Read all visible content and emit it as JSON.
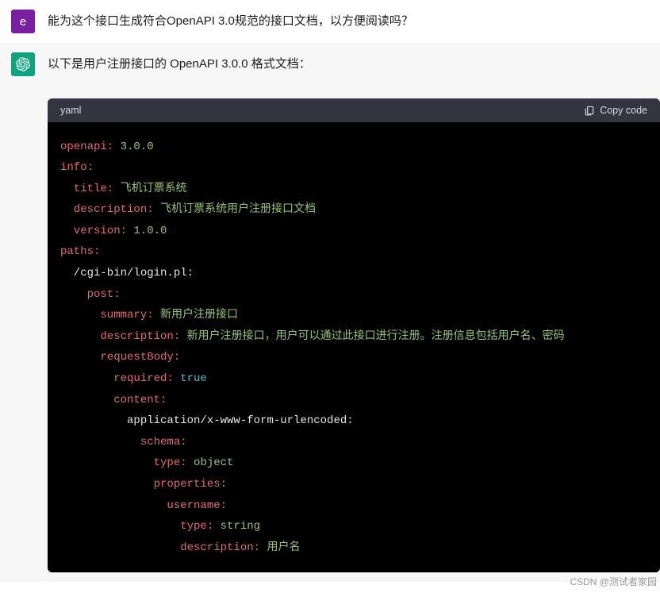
{
  "user": {
    "avatar_letter": "e",
    "text": "能为这个接口生成符合OpenAPI 3.0规范的接口文档，以方便阅读吗？"
  },
  "assistant": {
    "text": "以下是用户注册接口的 OpenAPI 3.0.0 格式文档："
  },
  "code": {
    "lang": "yaml",
    "copy_label": "Copy code",
    "lines": {
      "l1k": "openapi:",
      "l1v": " 3.0.0",
      "l2k": "info:",
      "l3k": "  title:",
      "l3v": " 飞机订票系统",
      "l4k": "  description:",
      "l4v": " 飞机订票系统用户注册接口文档",
      "l5k": "  version:",
      "l5v": " 1.0.0",
      "l6k": "paths:",
      "l7": "  /cgi-bin/login.pl:",
      "l8k": "    post:",
      "l9k": "      summary:",
      "l9v": " 新用户注册接口",
      "l10k": "      description:",
      "l10v": " 新用户注册接口，用户可以通过此接口进行注册。注册信息包括用户名、密码",
      "l11k": "      requestBody:",
      "l12k": "        required:",
      "l12v": " true",
      "l13k": "        content:",
      "l14": "          application/x-www-form-urlencoded:",
      "l15k": "            schema:",
      "l16k": "              type:",
      "l16v": " object",
      "l17k": "              properties:",
      "l18k": "                username:",
      "l19k": "                  type:",
      "l19v": " string",
      "l20k": "                  description:",
      "l20v": " 用户名"
    }
  },
  "watermark": "CSDN @测试者家园"
}
